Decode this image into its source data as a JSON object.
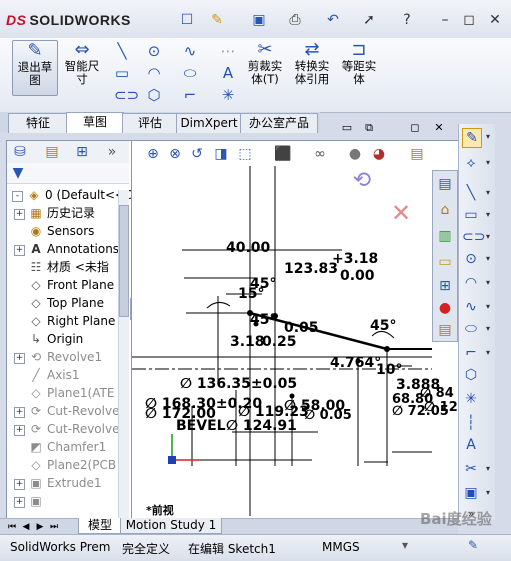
{
  "app": {
    "brand": "SOLIDWORKS",
    "brand_prefix": "DS"
  },
  "quick_access": [
    "new-icon",
    "open-icon",
    "save-icon",
    "print-icon",
    "undo-icon",
    "select-icon",
    "help-icon"
  ],
  "window_buttons": [
    "minimize-icon",
    "restore-icon",
    "close-icon"
  ],
  "command_manager": {
    "exit_sketch": {
      "line1": "退出草",
      "line2": "图"
    },
    "smart_dim": {
      "line1": "智能尺",
      "line2": "寸"
    },
    "trim": {
      "line1": "剪裁实",
      "line2": "体(T)"
    },
    "convert": {
      "line1": "转换实",
      "line2": "体引用"
    },
    "offset": {
      "line1": "等距实",
      "line2": "体"
    }
  },
  "tabs": [
    "特征",
    "草图",
    "评估",
    "DimXpert",
    "办公室产品"
  ],
  "active_tab": "草图",
  "feature_tree": [
    {
      "label": "(Default<<D",
      "state": "normal",
      "expand": "-",
      "icon": "part-icon"
    },
    {
      "label": "历史记录",
      "state": "normal",
      "expand": "+",
      "icon": "history-icon"
    },
    {
      "label": "Sensors",
      "state": "normal",
      "expand": "",
      "icon": "sensor-icon"
    },
    {
      "label": "Annotations",
      "state": "normal",
      "expand": "+",
      "icon": "annotation-icon"
    },
    {
      "label": "材质 <未指",
      "state": "normal",
      "expand": "",
      "icon": "material-icon"
    },
    {
      "label": "Front Plane",
      "state": "normal",
      "expand": "",
      "icon": "plane-icon"
    },
    {
      "label": "Top Plane",
      "state": "normal",
      "expand": "",
      "icon": "plane-icon"
    },
    {
      "label": "Right Plane",
      "state": "normal",
      "expand": "",
      "icon": "plane-icon"
    },
    {
      "label": "Origin",
      "state": "normal",
      "expand": "",
      "icon": "origin-icon"
    },
    {
      "label": "Revolve1",
      "state": "dim",
      "expand": "+",
      "icon": "revolve-icon"
    },
    {
      "label": "Axis1",
      "state": "dim",
      "expand": "",
      "icon": "axis-icon"
    },
    {
      "label": "Plane1(ATE",
      "state": "dim",
      "expand": "",
      "icon": "plane-icon"
    },
    {
      "label": "Cut-Revolve",
      "state": "dim",
      "expand": "+",
      "icon": "cut-revolve-icon"
    },
    {
      "label": "Cut-Revolve",
      "state": "dim",
      "expand": "+",
      "icon": "cut-revolve-icon"
    },
    {
      "label": "Chamfer1",
      "state": "dim",
      "expand": "",
      "icon": "chamfer-icon"
    },
    {
      "label": "Plane2(PCB",
      "state": "dim",
      "expand": "",
      "icon": "plane-icon"
    },
    {
      "label": "Extrude1",
      "state": "dim",
      "expand": "+",
      "icon": "extrude-icon"
    }
  ],
  "feature_tree_root_number": "0",
  "dimensions": [
    "40.00",
    "45°",
    "123.83",
    "+3.18",
    "0.00",
    "15°",
    "45°",
    "0.05",
    "3.18",
    "0.25",
    "45°",
    "4.764°",
    "10°",
    "3.888",
    "68.80",
    "∅ 136.35±0.05",
    "∅ 168.30±0.20",
    "∅ 58.00",
    "∅ 172.00",
    "∅ 119.23",
    "∅ 0.05",
    "BEVEL",
    "∅ 124.91",
    "∅ 72.05",
    "∅ 84",
    "∅ 12"
  ],
  "view_label": "*前视",
  "bottom_tabs": [
    "模型",
    "Motion Study 1"
  ],
  "active_bottom_tab": "模型",
  "status": {
    "app": "SolidWorks Prem",
    "definition": "完全定义",
    "editing": "在编辑 Sketch1",
    "units": "MMGS"
  },
  "watermark": "Bai度经验",
  "colors": {
    "accent": "#2a55b5",
    "sketch_line": "#000000",
    "origin_x": "#d22222",
    "origin_y": "#1a9a1a"
  }
}
